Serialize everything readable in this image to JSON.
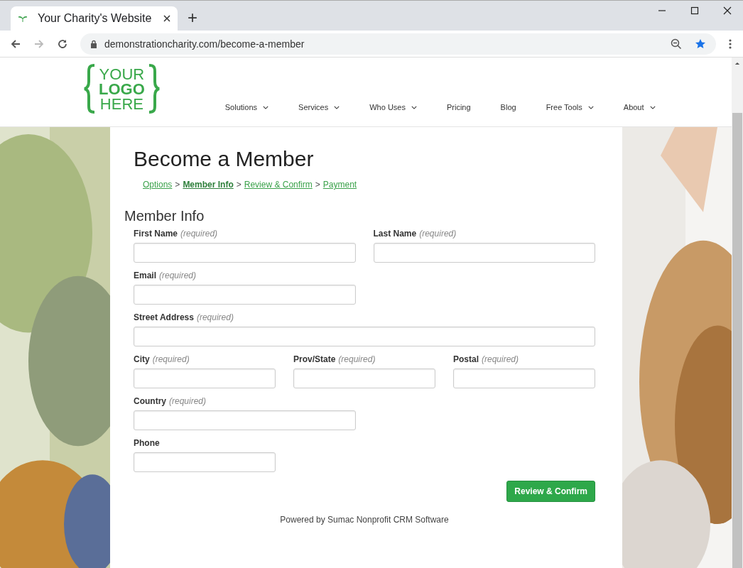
{
  "browser": {
    "tab_title": "Your Charity's Website",
    "new_tab": "+",
    "url": "demonstrationcharity.com/become-a-member"
  },
  "site": {
    "logo": [
      "YOUR",
      "LOGO",
      "HERE"
    ],
    "nav": [
      {
        "label": "Solutions",
        "dropdown": true
      },
      {
        "label": "Services",
        "dropdown": true
      },
      {
        "label": "Who Uses",
        "dropdown": true
      },
      {
        "label": "Pricing",
        "dropdown": false
      },
      {
        "label": "Blog",
        "dropdown": false
      },
      {
        "label": "Free Tools",
        "dropdown": true
      },
      {
        "label": "About",
        "dropdown": true
      }
    ]
  },
  "page": {
    "title": "Become a Member",
    "steps": [
      {
        "label": "Options",
        "selected": false
      },
      {
        "label": "Member Info",
        "selected": true
      },
      {
        "label": "Review & Confirm",
        "selected": false
      },
      {
        "label": "Payment",
        "selected": false
      }
    ],
    "separator": ">",
    "section": "Member Info",
    "rows": [
      [
        {
          "label": "First Name",
          "note": "(required)"
        },
        {
          "label": "Last Name",
          "note": "(required)"
        }
      ],
      [
        {
          "label": "Email",
          "note": "(required)"
        }
      ],
      [
        {
          "label": "Street Address",
          "note": "(required)"
        }
      ],
      [
        {
          "label": "City",
          "note": "(required)"
        },
        {
          "label": "Prov/State",
          "note": "(required)"
        },
        {
          "label": "Postal",
          "note": "(required)"
        }
      ],
      [
        {
          "label": "Country",
          "note": "(required)"
        }
      ],
      [
        {
          "label": "Phone"
        }
      ]
    ],
    "submit": "Review & Confirm",
    "footer": "Powered by Sumac Nonprofit CRM Software"
  }
}
